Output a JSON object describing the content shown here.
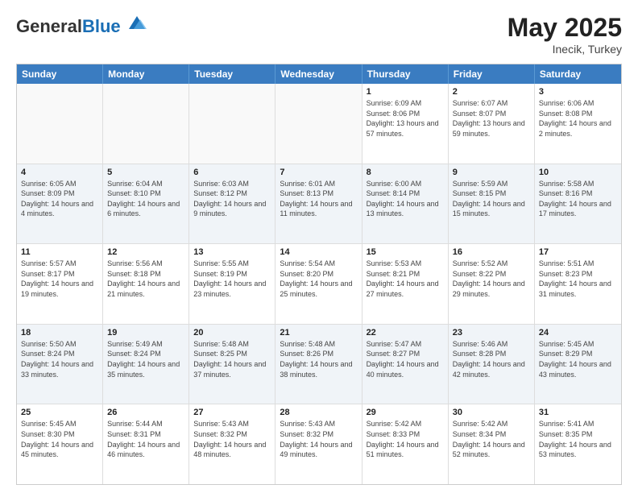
{
  "logo": {
    "general": "General",
    "blue": "Blue"
  },
  "title": {
    "month": "May 2025",
    "location": "Inecik, Turkey"
  },
  "header_days": [
    "Sunday",
    "Monday",
    "Tuesday",
    "Wednesday",
    "Thursday",
    "Friday",
    "Saturday"
  ],
  "rows": [
    {
      "alt": false,
      "cells": [
        {
          "empty": true,
          "day": "",
          "text": ""
        },
        {
          "empty": true,
          "day": "",
          "text": ""
        },
        {
          "empty": true,
          "day": "",
          "text": ""
        },
        {
          "empty": true,
          "day": "",
          "text": ""
        },
        {
          "empty": false,
          "day": "1",
          "text": "Sunrise: 6:09 AM\nSunset: 8:06 PM\nDaylight: 13 hours and 57 minutes."
        },
        {
          "empty": false,
          "day": "2",
          "text": "Sunrise: 6:07 AM\nSunset: 8:07 PM\nDaylight: 13 hours and 59 minutes."
        },
        {
          "empty": false,
          "day": "3",
          "text": "Sunrise: 6:06 AM\nSunset: 8:08 PM\nDaylight: 14 hours and 2 minutes."
        }
      ]
    },
    {
      "alt": true,
      "cells": [
        {
          "empty": false,
          "day": "4",
          "text": "Sunrise: 6:05 AM\nSunset: 8:09 PM\nDaylight: 14 hours and 4 minutes."
        },
        {
          "empty": false,
          "day": "5",
          "text": "Sunrise: 6:04 AM\nSunset: 8:10 PM\nDaylight: 14 hours and 6 minutes."
        },
        {
          "empty": false,
          "day": "6",
          "text": "Sunrise: 6:03 AM\nSunset: 8:12 PM\nDaylight: 14 hours and 9 minutes."
        },
        {
          "empty": false,
          "day": "7",
          "text": "Sunrise: 6:01 AM\nSunset: 8:13 PM\nDaylight: 14 hours and 11 minutes."
        },
        {
          "empty": false,
          "day": "8",
          "text": "Sunrise: 6:00 AM\nSunset: 8:14 PM\nDaylight: 14 hours and 13 minutes."
        },
        {
          "empty": false,
          "day": "9",
          "text": "Sunrise: 5:59 AM\nSunset: 8:15 PM\nDaylight: 14 hours and 15 minutes."
        },
        {
          "empty": false,
          "day": "10",
          "text": "Sunrise: 5:58 AM\nSunset: 8:16 PM\nDaylight: 14 hours and 17 minutes."
        }
      ]
    },
    {
      "alt": false,
      "cells": [
        {
          "empty": false,
          "day": "11",
          "text": "Sunrise: 5:57 AM\nSunset: 8:17 PM\nDaylight: 14 hours and 19 minutes."
        },
        {
          "empty": false,
          "day": "12",
          "text": "Sunrise: 5:56 AM\nSunset: 8:18 PM\nDaylight: 14 hours and 21 minutes."
        },
        {
          "empty": false,
          "day": "13",
          "text": "Sunrise: 5:55 AM\nSunset: 8:19 PM\nDaylight: 14 hours and 23 minutes."
        },
        {
          "empty": false,
          "day": "14",
          "text": "Sunrise: 5:54 AM\nSunset: 8:20 PM\nDaylight: 14 hours and 25 minutes."
        },
        {
          "empty": false,
          "day": "15",
          "text": "Sunrise: 5:53 AM\nSunset: 8:21 PM\nDaylight: 14 hours and 27 minutes."
        },
        {
          "empty": false,
          "day": "16",
          "text": "Sunrise: 5:52 AM\nSunset: 8:22 PM\nDaylight: 14 hours and 29 minutes."
        },
        {
          "empty": false,
          "day": "17",
          "text": "Sunrise: 5:51 AM\nSunset: 8:23 PM\nDaylight: 14 hours and 31 minutes."
        }
      ]
    },
    {
      "alt": true,
      "cells": [
        {
          "empty": false,
          "day": "18",
          "text": "Sunrise: 5:50 AM\nSunset: 8:24 PM\nDaylight: 14 hours and 33 minutes."
        },
        {
          "empty": false,
          "day": "19",
          "text": "Sunrise: 5:49 AM\nSunset: 8:24 PM\nDaylight: 14 hours and 35 minutes."
        },
        {
          "empty": false,
          "day": "20",
          "text": "Sunrise: 5:48 AM\nSunset: 8:25 PM\nDaylight: 14 hours and 37 minutes."
        },
        {
          "empty": false,
          "day": "21",
          "text": "Sunrise: 5:48 AM\nSunset: 8:26 PM\nDaylight: 14 hours and 38 minutes."
        },
        {
          "empty": false,
          "day": "22",
          "text": "Sunrise: 5:47 AM\nSunset: 8:27 PM\nDaylight: 14 hours and 40 minutes."
        },
        {
          "empty": false,
          "day": "23",
          "text": "Sunrise: 5:46 AM\nSunset: 8:28 PM\nDaylight: 14 hours and 42 minutes."
        },
        {
          "empty": false,
          "day": "24",
          "text": "Sunrise: 5:45 AM\nSunset: 8:29 PM\nDaylight: 14 hours and 43 minutes."
        }
      ]
    },
    {
      "alt": false,
      "cells": [
        {
          "empty": false,
          "day": "25",
          "text": "Sunrise: 5:45 AM\nSunset: 8:30 PM\nDaylight: 14 hours and 45 minutes."
        },
        {
          "empty": false,
          "day": "26",
          "text": "Sunrise: 5:44 AM\nSunset: 8:31 PM\nDaylight: 14 hours and 46 minutes."
        },
        {
          "empty": false,
          "day": "27",
          "text": "Sunrise: 5:43 AM\nSunset: 8:32 PM\nDaylight: 14 hours and 48 minutes."
        },
        {
          "empty": false,
          "day": "28",
          "text": "Sunrise: 5:43 AM\nSunset: 8:32 PM\nDaylight: 14 hours and 49 minutes."
        },
        {
          "empty": false,
          "day": "29",
          "text": "Sunrise: 5:42 AM\nSunset: 8:33 PM\nDaylight: 14 hours and 51 minutes."
        },
        {
          "empty": false,
          "day": "30",
          "text": "Sunrise: 5:42 AM\nSunset: 8:34 PM\nDaylight: 14 hours and 52 minutes."
        },
        {
          "empty": false,
          "day": "31",
          "text": "Sunrise: 5:41 AM\nSunset: 8:35 PM\nDaylight: 14 hours and 53 minutes."
        }
      ]
    }
  ]
}
